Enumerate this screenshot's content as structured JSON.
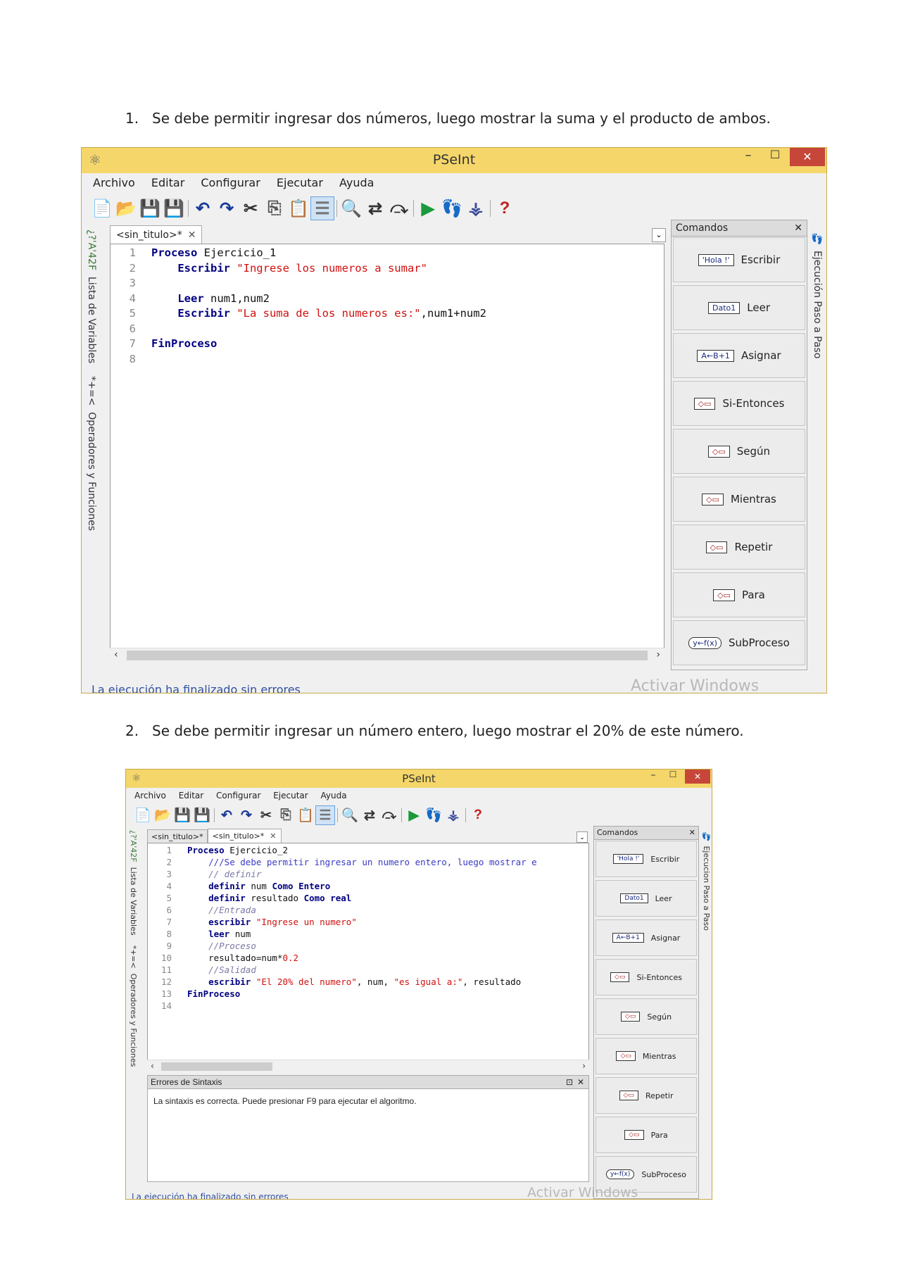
{
  "questions": [
    {
      "number": "1.",
      "text": "Se debe permitir ingresar dos números, luego mostrar la suma y el producto de ambos."
    },
    {
      "number": "2.",
      "text": "Se debe permitir ingresar un número entero, luego mostrar el 20% de este número."
    }
  ],
  "window1": {
    "title": "PSeInt",
    "menu": [
      "Archivo",
      "Editar",
      "Configurar",
      "Ejecutar",
      "Ayuda"
    ],
    "tabs": [
      {
        "label": "<sin_titulo>*"
      }
    ],
    "left_tab_1": "Lista de Variables",
    "left_tab_1_glyphs": "*+=<",
    "left_tab_2": "Operadores y Funciones",
    "left_tab_2_glyphs": "¿?'A'42F",
    "right_tab": "Ejecución Paso a Paso",
    "panel_title": "Comandos",
    "commands": [
      "Escribir",
      "Leer",
      "Asignar",
      "Si-Entonces",
      "Según",
      "Mientras",
      "Repetir",
      "Para",
      "SubProceso"
    ],
    "command_icons": [
      "'Hola !'",
      "Dato1",
      "A←B+1",
      "",
      "",
      "",
      "",
      "",
      "y←f(x)"
    ],
    "status": "La ejecución ha finalizado sin errores",
    "watermark": "Activar Windows",
    "code": [
      {
        "n": "1",
        "parts": [
          {
            "t": "Proceso",
            "c": "kw"
          },
          {
            "t": " Ejercicio_1",
            "c": "plain"
          }
        ]
      },
      {
        "n": "2",
        "parts": [
          {
            "t": "    ",
            "c": "plain"
          },
          {
            "t": "Escribir",
            "c": "kw"
          },
          {
            "t": " \"Ingrese los numeros a sumar\"",
            "c": "str"
          }
        ]
      },
      {
        "n": "3",
        "parts": []
      },
      {
        "n": "4",
        "parts": [
          {
            "t": "    ",
            "c": "plain"
          },
          {
            "t": "Leer",
            "c": "kw"
          },
          {
            "t": " num1,num2",
            "c": "plain"
          }
        ]
      },
      {
        "n": "5",
        "parts": [
          {
            "t": "    ",
            "c": "plain"
          },
          {
            "t": "Escribir",
            "c": "kw"
          },
          {
            "t": " \"La suma de los numeros es:\"",
            "c": "str"
          },
          {
            "t": ",num1+num2",
            "c": "plain"
          }
        ]
      },
      {
        "n": "6",
        "parts": []
      },
      {
        "n": "7",
        "parts": [
          {
            "t": "FinProceso",
            "c": "kw"
          }
        ]
      },
      {
        "n": "8",
        "parts": []
      }
    ]
  },
  "window2": {
    "title": "PSeInt",
    "menu": [
      "Archivo",
      "Editar",
      "Configurar",
      "Ejecutar",
      "Ayuda"
    ],
    "tabs": [
      {
        "label": "<sin_titulo>*"
      },
      {
        "label": "<sin_titulo>*"
      }
    ],
    "left_tab_1": "Lista de Variables",
    "left_tab_1_glyphs": "*+=<",
    "left_tab_2": "Operadores y Funciones",
    "left_tab_2_glyphs": "¿?'A'42F",
    "right_tab": "Ejecucion Paso a Paso",
    "panel_title": "Comandos",
    "commands": [
      "Escribir",
      "Leer",
      "Asignar",
      "Si-Entonces",
      "Según",
      "Mientras",
      "Repetir",
      "Para",
      "SubProceso"
    ],
    "command_icons": [
      "'Hola !'",
      "Dato1",
      "A←B+1",
      "",
      "",
      "",
      "",
      "",
      "y←f(x)"
    ],
    "errors_title": "Errores de Sintaxis",
    "errors_message": "La sintaxis es correcta. Puede presionar F9 para ejecutar el algoritmo.",
    "status": "La ejecución ha finalizado sin errores",
    "watermark": "Activar Windows",
    "code": [
      {
        "n": "1",
        "parts": [
          {
            "t": "Proceso",
            "c": "kw"
          },
          {
            "t": " Ejercicio_2",
            "c": "plain"
          }
        ]
      },
      {
        "n": "2",
        "parts": [
          {
            "t": "    ",
            "c": "plain"
          },
          {
            "t": "///Se debe permitir ingresar un numero entero, luego mostrar e",
            "c": "cmblue"
          }
        ]
      },
      {
        "n": "3",
        "parts": [
          {
            "t": "    ",
            "c": "plain"
          },
          {
            "t": "// definir",
            "c": "cm"
          }
        ]
      },
      {
        "n": "4",
        "parts": [
          {
            "t": "    ",
            "c": "plain"
          },
          {
            "t": "definir",
            "c": "kw"
          },
          {
            "t": " num ",
            "c": "plain"
          },
          {
            "t": "Como Entero",
            "c": "kw"
          }
        ]
      },
      {
        "n": "5",
        "parts": [
          {
            "t": "    ",
            "c": "plain"
          },
          {
            "t": "definir",
            "c": "kw"
          },
          {
            "t": " resultado ",
            "c": "plain"
          },
          {
            "t": "Como real",
            "c": "kw"
          }
        ]
      },
      {
        "n": "6",
        "parts": [
          {
            "t": "    ",
            "c": "plain"
          },
          {
            "t": "//Entrada",
            "c": "cm"
          }
        ]
      },
      {
        "n": "7",
        "parts": [
          {
            "t": "    ",
            "c": "plain"
          },
          {
            "t": "escribir",
            "c": "kw"
          },
          {
            "t": " \"Ingrese un numero\"",
            "c": "str"
          }
        ]
      },
      {
        "n": "8",
        "parts": [
          {
            "t": "    ",
            "c": "plain"
          },
          {
            "t": "leer",
            "c": "kw"
          },
          {
            "t": " num",
            "c": "plain"
          }
        ]
      },
      {
        "n": "9",
        "parts": [
          {
            "t": "    ",
            "c": "plain"
          },
          {
            "t": "//Proceso",
            "c": "cm"
          }
        ]
      },
      {
        "n": "10",
        "parts": [
          {
            "t": "    ",
            "c": "plain"
          },
          {
            "t": "resultado=num*",
            "c": "plain"
          },
          {
            "t": "0.2",
            "c": "num"
          }
        ]
      },
      {
        "n": "11",
        "parts": [
          {
            "t": "    ",
            "c": "plain"
          },
          {
            "t": "//Salidad",
            "c": "cm"
          }
        ]
      },
      {
        "n": "12",
        "parts": [
          {
            "t": "    ",
            "c": "plain"
          },
          {
            "t": "escribir",
            "c": "kw"
          },
          {
            "t": " \"El 20% del numero\"",
            "c": "str"
          },
          {
            "t": ", num, ",
            "c": "plain"
          },
          {
            "t": "\"es igual a:\"",
            "c": "str"
          },
          {
            "t": ", resultado",
            "c": "plain"
          }
        ]
      },
      {
        "n": "13",
        "parts": [
          {
            "t": "FinProceso",
            "c": "kw"
          }
        ]
      },
      {
        "n": "14",
        "parts": []
      }
    ]
  },
  "colors": {
    "titlebar": "#f5d66a",
    "close": "#c7463a",
    "keyword": "#000080",
    "string": "#d01010",
    "comment": "#7a7aa8"
  },
  "toolbar_icons": [
    "new-file",
    "open-folder",
    "save",
    "save-as",
    "undo",
    "redo",
    "cut",
    "copy",
    "paste",
    "indent",
    "find",
    "replace",
    "find-next",
    "run",
    "step",
    "flowchart",
    "help"
  ]
}
